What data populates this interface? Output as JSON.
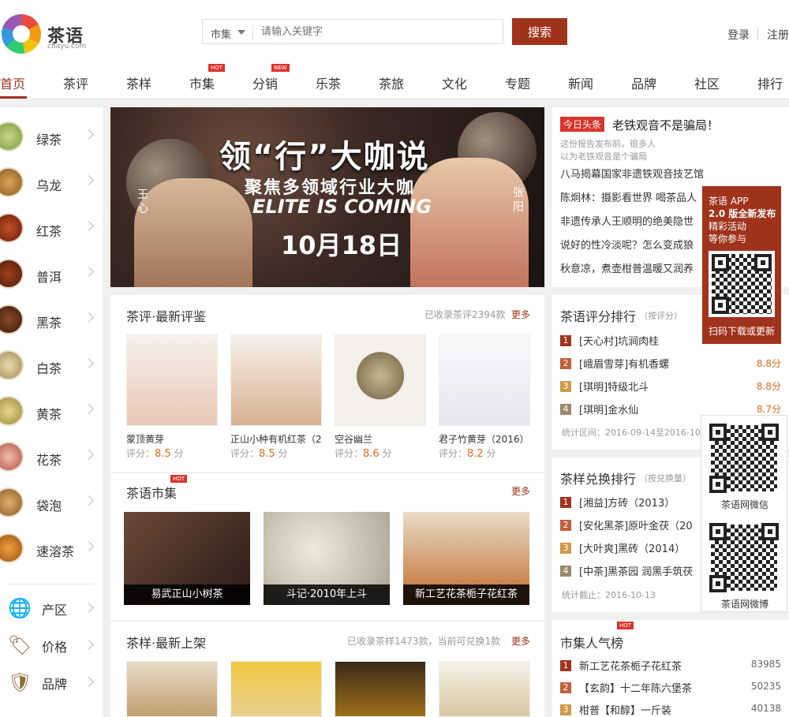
{
  "header": {
    "logo_text": "茶语",
    "logo_sub": "chayu.com",
    "search_scope": "市集",
    "search_placeholder": "请输入关键字",
    "search_button": "搜索",
    "login": "登录",
    "register": "注册"
  },
  "nav": {
    "items": [
      "首页",
      "茶评",
      "茶样",
      "市集",
      "分销",
      "乐茶",
      "茶旅",
      "文化",
      "专题",
      "新闻",
      "品牌",
      "社区",
      "排行"
    ],
    "badge_hot": "HOT",
    "badge_new": "NEW"
  },
  "sidebar": {
    "categories": [
      "绿茶",
      "乌龙",
      "红茶",
      "普洱",
      "黑茶",
      "白茶",
      "黄茶",
      "花茶",
      "袋泡",
      "速溶茶"
    ],
    "links": [
      "产区",
      "价格",
      "品牌"
    ]
  },
  "banner": {
    "title": "领“行”大咖说",
    "subtitle": "聚焦多领域行业大咖",
    "english": "ELITE IS COMING",
    "date": "10月18日",
    "left_name": "王心",
    "right_name": "张阳"
  },
  "news": {
    "today_tag": "今日头条",
    "headline": "老铁观音不是骗局！",
    "summary": "这份报告发布前，很多人以为老铁观音是个骗局",
    "items": [
      "八马揭幕国家非遗铁观音技艺馆",
      "陈炯林：摄影看世界 喝茶品人",
      "非遗传承人王顺明的绝美隐世",
      "说好的性冷淡呢？怎么变成狼",
      "秋意凉，煮壶柑普温暖又润养"
    ]
  },
  "app_promo": {
    "line1": "茶语 APP",
    "line2": "2.0 版全新发布",
    "line3": "精彩活动",
    "line4": "等你参与",
    "line5": "扫码下载或更新"
  },
  "reviews": {
    "title": "茶评·最新评鉴",
    "meta": "已收录茶评2394款",
    "more": "更多",
    "score_prefix": "评分：",
    "score_suffix": "分",
    "items": [
      {
        "name": "蒙顶黄芽",
        "score": "8.5"
      },
      {
        "name": "正山小种有机红茶（2",
        "score": "8.5"
      },
      {
        "name": "空谷幽兰",
        "score": "8.6"
      },
      {
        "name": "君子竹黄芽（2016）",
        "score": "8.2"
      }
    ]
  },
  "market": {
    "title": "茶语市集",
    "more": "更多",
    "badge": "HOT",
    "items": [
      "易武正山小树茶",
      "斗记·2010年上斗",
      "新工艺花茶栀子花红茶"
    ]
  },
  "samples": {
    "title": "茶样·最新上架",
    "meta": "已收录茶样1473款，当前可兑换1款",
    "more": "更多"
  },
  "rating_rank": {
    "title": "茶语评分排行",
    "sub": "（按评分）",
    "items": [
      {
        "n": "1",
        "t": "[天心村]坑涧肉桂",
        "v": ""
      },
      {
        "n": "2",
        "t": "[峨眉雪芽]有机香螺",
        "v": "8.8分"
      },
      {
        "n": "3",
        "t": "[琪明]特级北斗",
        "v": "8.8分"
      },
      {
        "n": "4",
        "t": "[琪明]金水仙",
        "v": "8.7分"
      }
    ],
    "note": "统计区间：2016-09-14至2016-10-"
  },
  "exchange_rank": {
    "title": "茶样兑换排行",
    "sub": "（按兑换量）",
    "items": [
      {
        "n": "1",
        "t": "[湘益]方砖（2013）"
      },
      {
        "n": "2",
        "t": "[安化黑茶]原叶金茯（20"
      },
      {
        "n": "3",
        "t": "[大叶爽]黑砖（2014）"
      },
      {
        "n": "4",
        "t": "[中茶]黑茶园 润黑手筑茯"
      }
    ],
    "note": "统计截止：2016-10-13"
  },
  "popular": {
    "title": "市集人气榜",
    "badge": "HOT",
    "items": [
      {
        "n": "1",
        "t": "新工艺花茶栀子花红茶",
        "v": "83985"
      },
      {
        "n": "2",
        "t": "【玄韵】十二年陈六堡茶",
        "v": "50235"
      },
      {
        "n": "3",
        "t": "柑普【和醇】一斤装",
        "v": "40138"
      }
    ]
  },
  "wechat": {
    "cap1": "茶语网微信",
    "cap2": "茶语网微博"
  },
  "colors": {
    "brand": "#a0331b",
    "hot": "#d9342b",
    "score": "#e06b1b"
  }
}
